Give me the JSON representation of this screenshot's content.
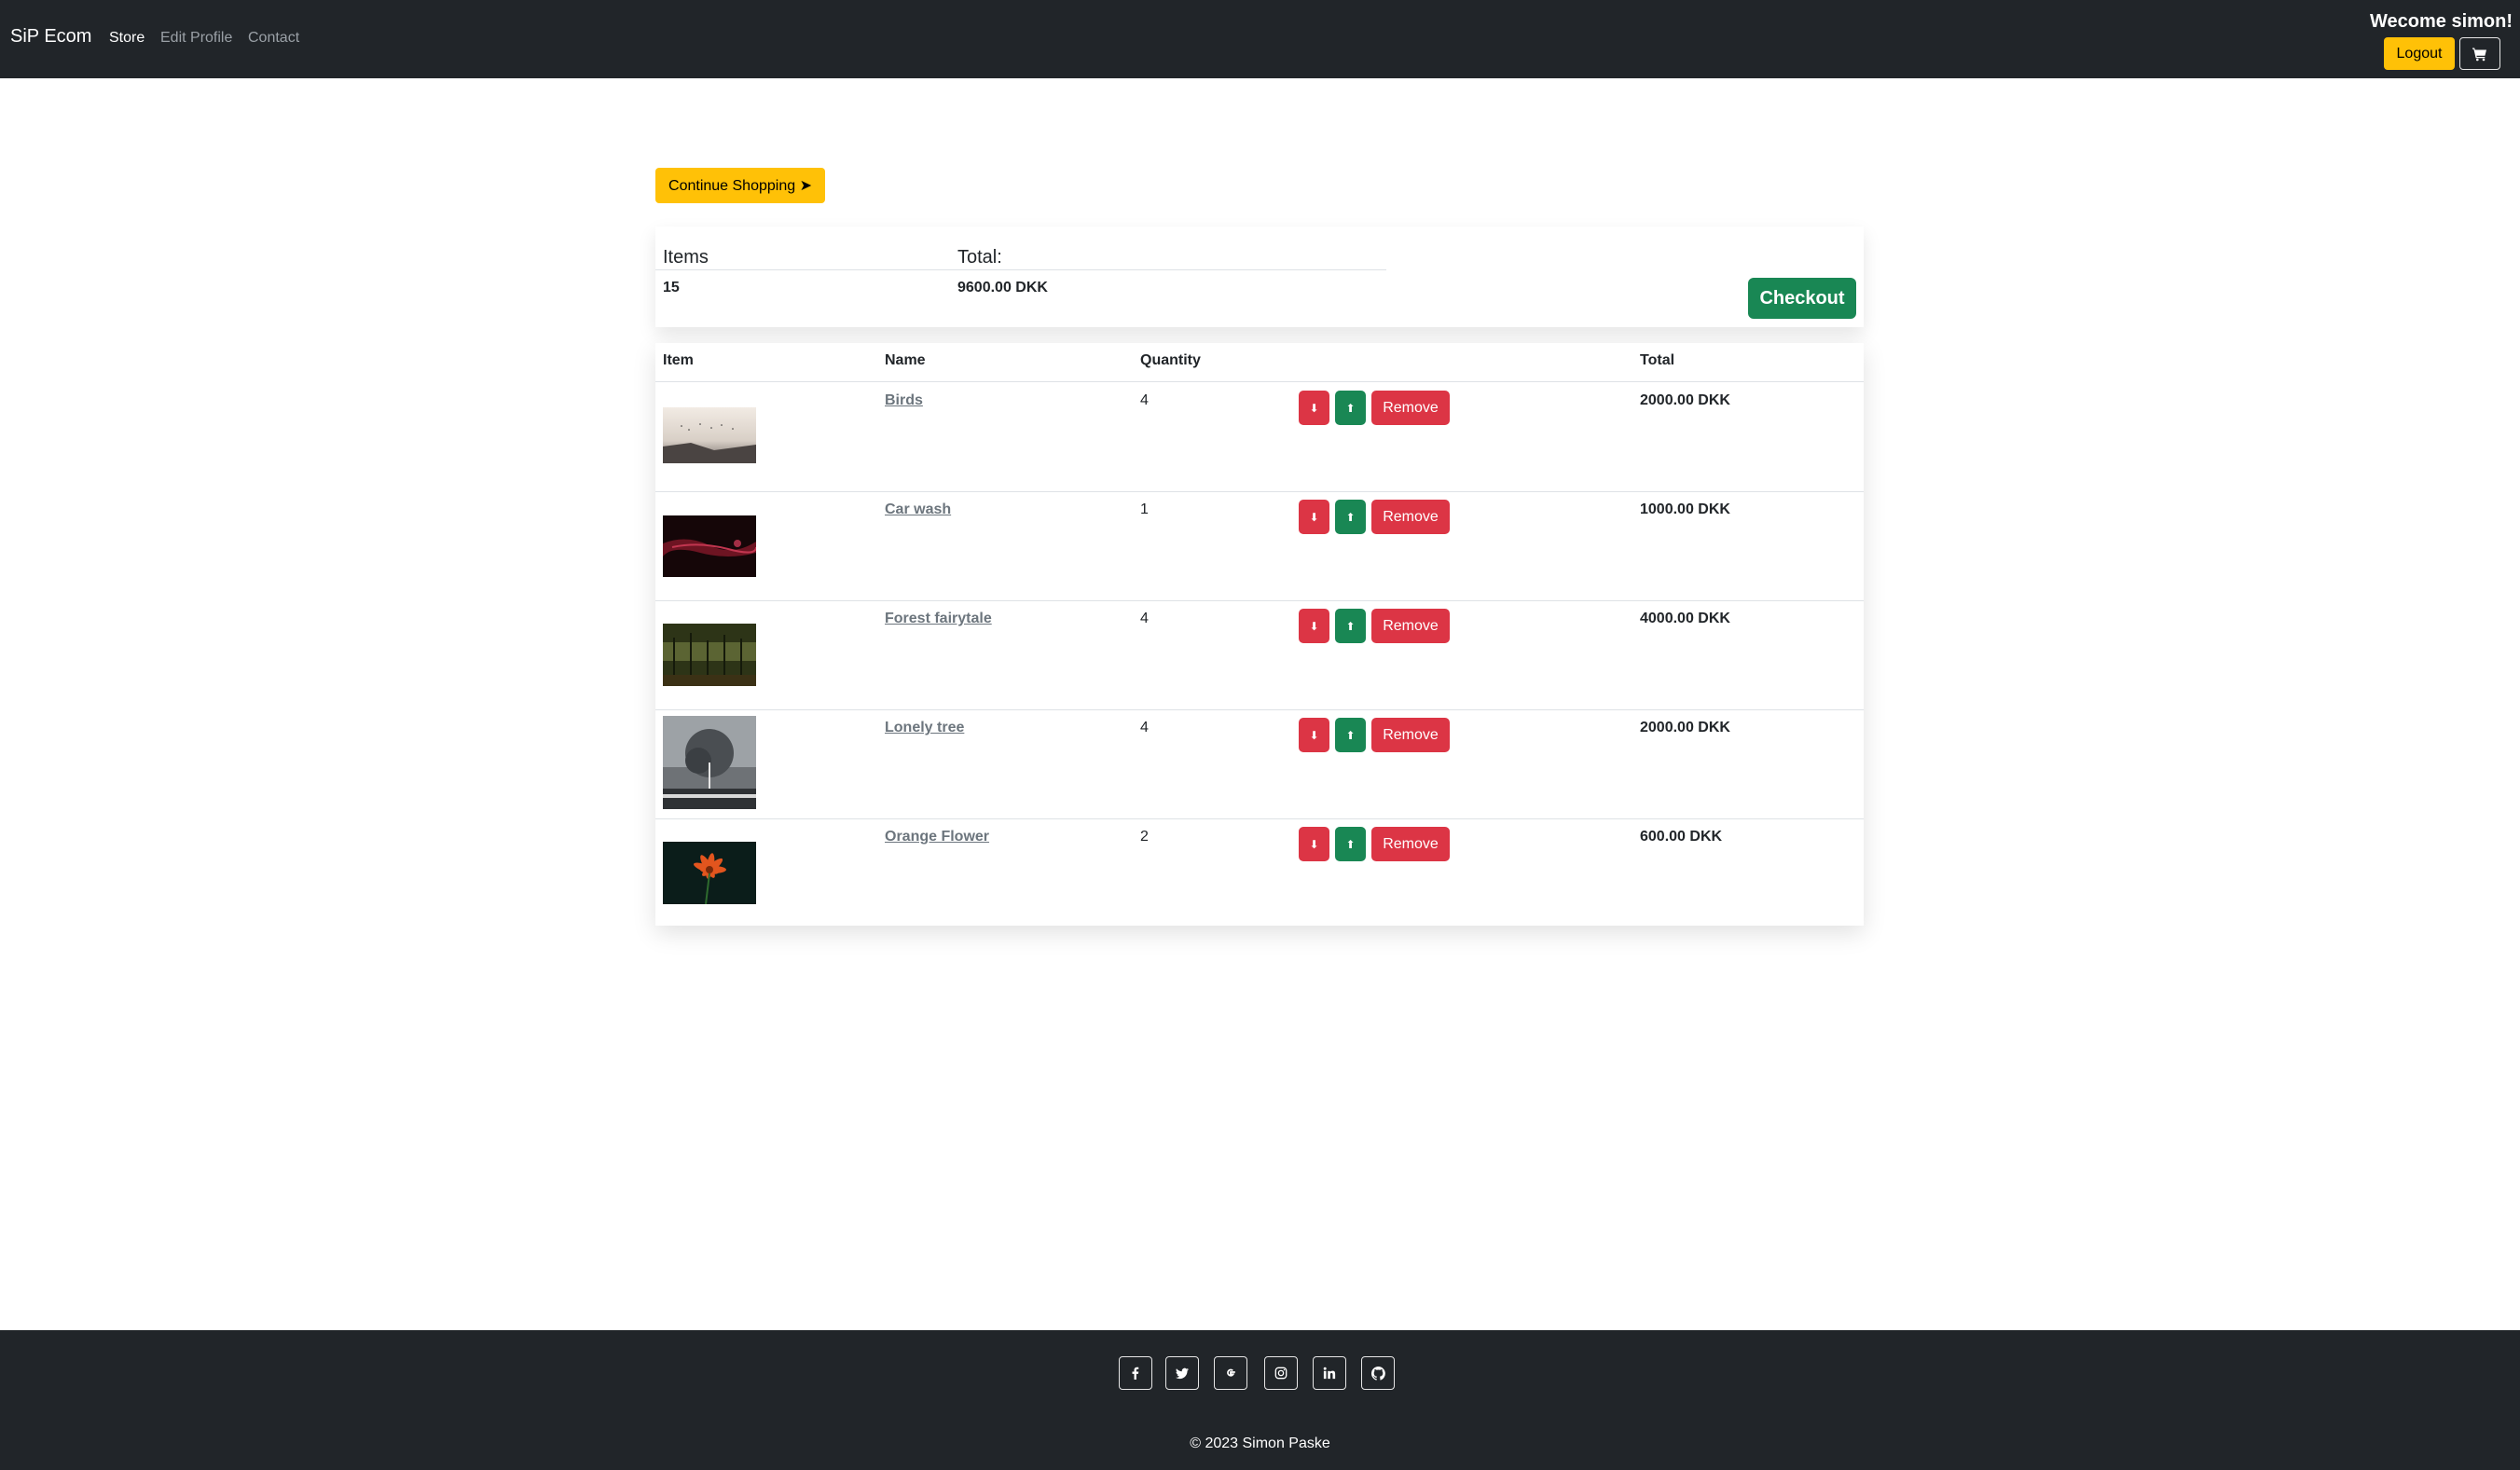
{
  "nav": {
    "brand": "SiP Ecom",
    "links": [
      "Store",
      "Edit Profile",
      "Contact"
    ],
    "welcome": "Wecome simon!",
    "logout_label": "Logout"
  },
  "continue_label": "Continue Shopping ➤",
  "summary": {
    "items_label": "Items",
    "total_label": "Total:",
    "items_value": "15",
    "total_value": "9600.00 DKK",
    "checkout_label": "Checkout"
  },
  "table": {
    "headers": [
      "Item",
      "Name",
      "Quantity",
      "Total"
    ],
    "remove_label": "Remove",
    "decrement_glyph": "⬇",
    "increment_glyph": "⬆",
    "rows": [
      {
        "name": "Birds",
        "quantity": "4",
        "total": "2000.00 DKK"
      },
      {
        "name": "Car wash",
        "quantity": "1",
        "total": "1000.00 DKK"
      },
      {
        "name": "Forest fairytale",
        "quantity": "4",
        "total": "4000.00 DKK"
      },
      {
        "name": "Lonely tree",
        "quantity": "4",
        "total": "2000.00 DKK"
      },
      {
        "name": "Orange Flower",
        "quantity": "2",
        "total": "600.00 DKK"
      }
    ]
  },
  "footer": {
    "icons": [
      "facebook-icon",
      "twitter-icon",
      "google-icon",
      "instagram-icon",
      "linkedin-icon",
      "github-icon"
    ],
    "copyright": "© 2023 Simon Paske"
  },
  "colors": {
    "dark": "#212529",
    "warning": "#ffc107",
    "success": "#198754",
    "danger": "#dc3545"
  }
}
